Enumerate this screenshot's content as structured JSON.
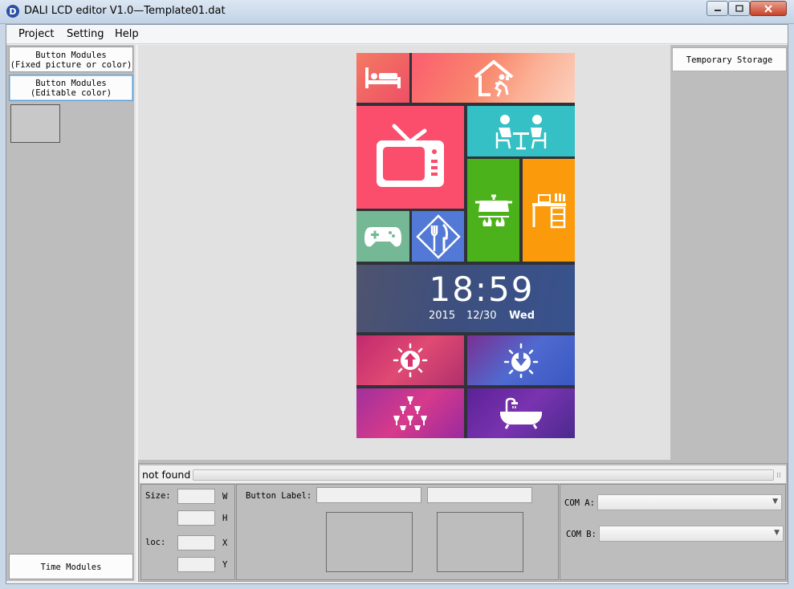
{
  "window": {
    "title": "DALI LCD editor V1.0—Template01.dat",
    "app_icon_letter": "D"
  },
  "menu": [
    {
      "label": "Project"
    },
    {
      "label": "Setting"
    },
    {
      "label": "Help"
    }
  ],
  "left_panel": {
    "button_fixed": "Button Modules\n(Fixed picture or color)",
    "button_editable": "Button Modules\n(Editable color)",
    "time_modules": "Time Modules"
  },
  "right_panel": {
    "temporary_storage": "Temporary Storage"
  },
  "status": {
    "text": "not found",
    "progress": 1.0
  },
  "properties": {
    "size_label": "Size:",
    "w_label": "W",
    "h_label": "H",
    "loc_label": "loc:",
    "x_label": "X",
    "y_label": "Y",
    "button_label": "Button Label:",
    "com_a_label": "COM A:",
    "com_b_label": "COM B:"
  },
  "phone": {
    "time": "18:59",
    "year": "2015",
    "date": "12/30",
    "weekday": "Wed",
    "tiles": [
      {
        "icon": "bed-icon",
        "color": "#f0635f"
      },
      {
        "icon": "home-icon",
        "color": "#f98a72"
      },
      {
        "icon": "tv-icon",
        "color": "#fb4d6c"
      },
      {
        "icon": "dining-icon",
        "color": "#34c0c4"
      },
      {
        "icon": "gamepad-icon",
        "color": "#75b896"
      },
      {
        "icon": "cutlery-icon",
        "color": "#5279d6"
      },
      {
        "icon": "cooking-pot-icon",
        "color": "#4cb21b"
      },
      {
        "icon": "desk-icon",
        "color": "#fb9a0a"
      },
      {
        "icon": "light-up-icon",
        "color": "#d8336d"
      },
      {
        "icon": "light-down-icon",
        "color": "#5468c8"
      },
      {
        "icon": "champagne-tower-icon",
        "color": "#c43593"
      },
      {
        "icon": "bathtub-icon",
        "color": "#6a2ba3"
      }
    ],
    "clock_panel_color": "#42557a"
  }
}
